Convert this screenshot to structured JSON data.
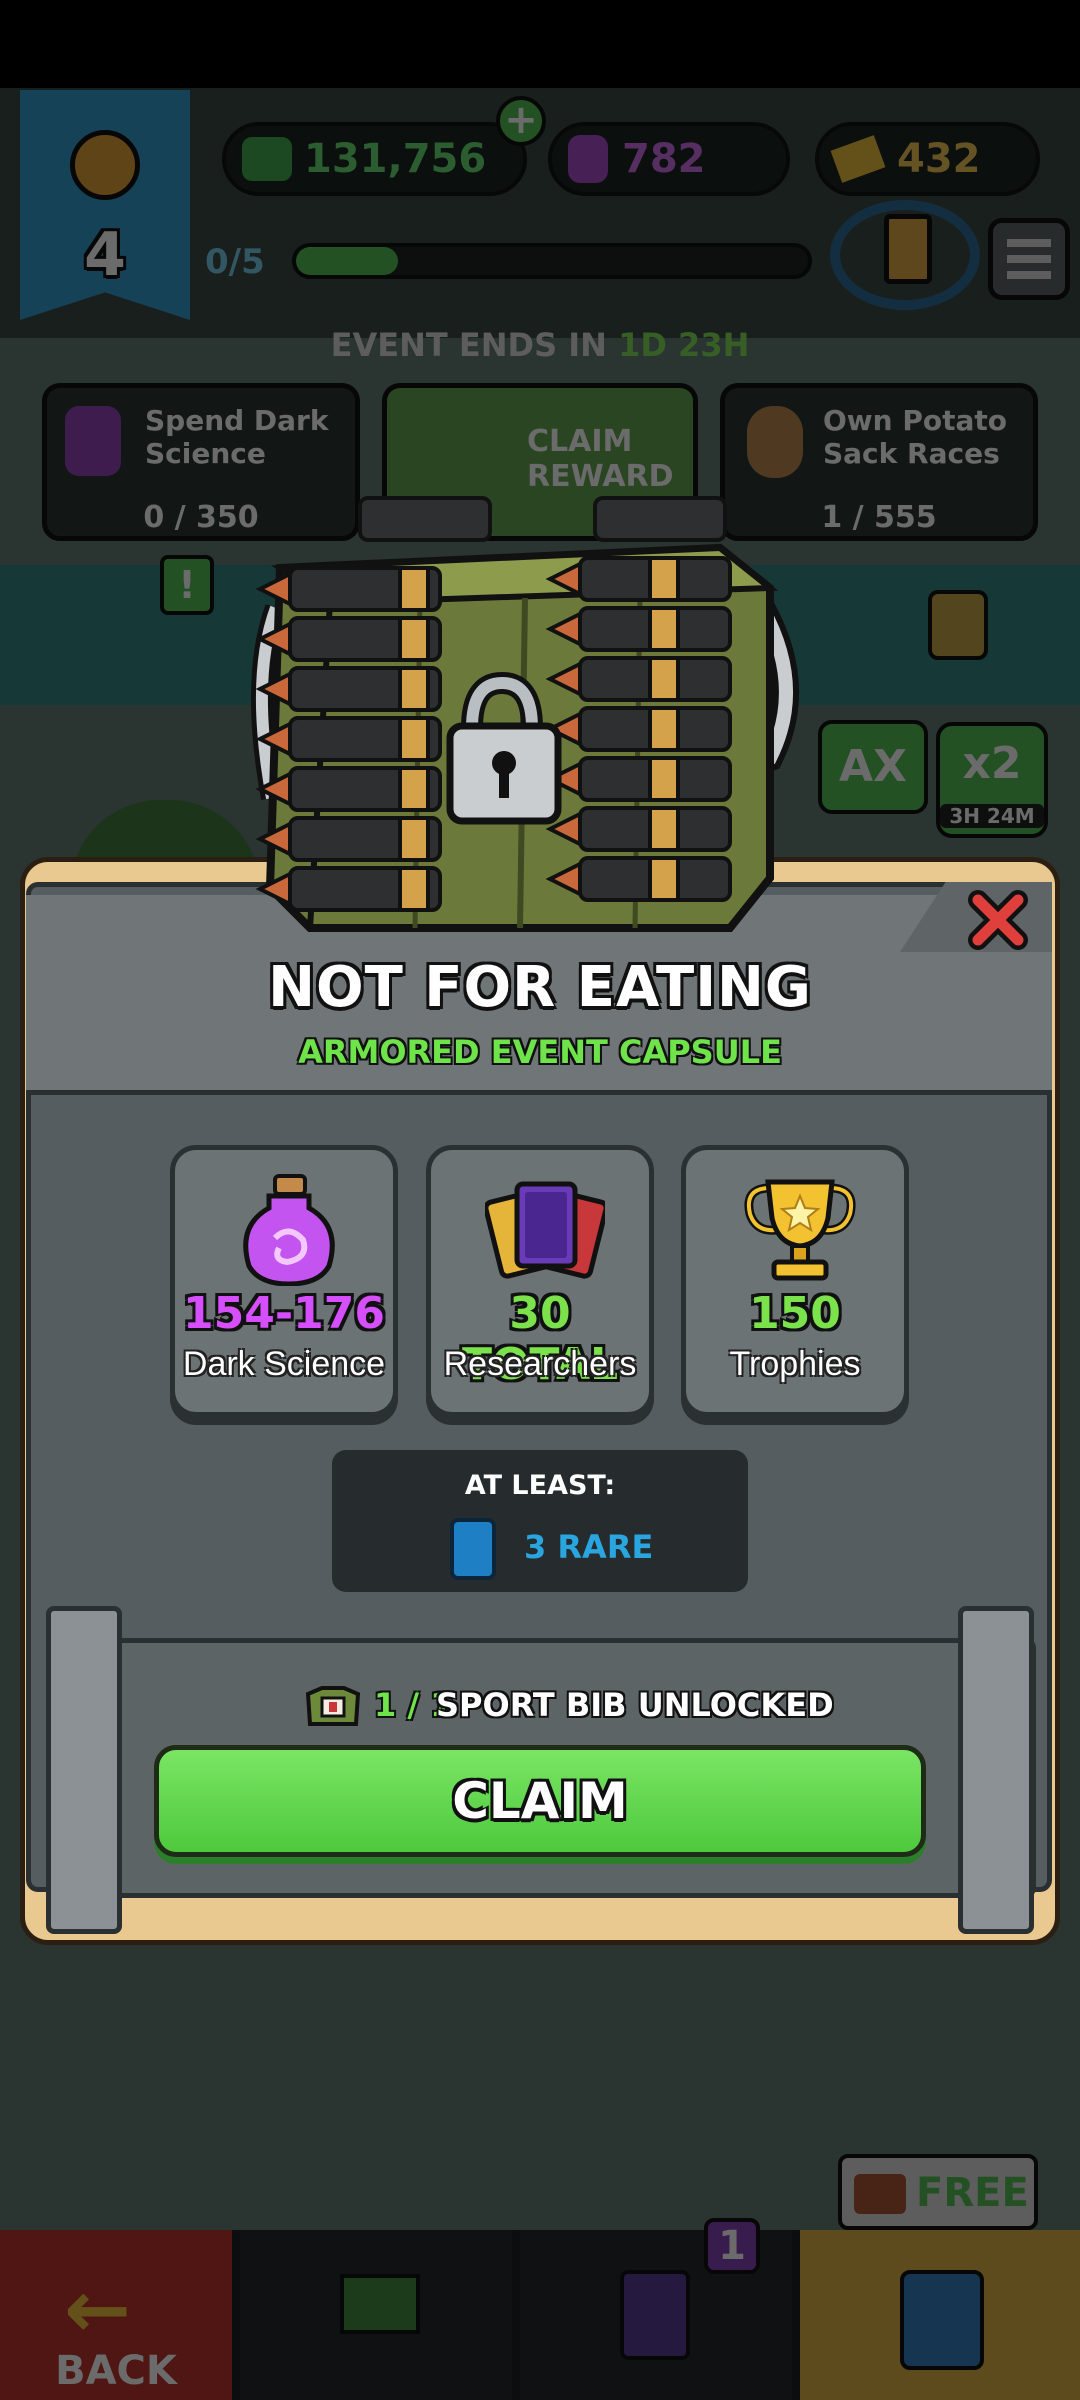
{
  "background": {
    "timer_level": "4",
    "currency_green": "131,756",
    "currency_dark_science": "782",
    "currency_tickets": "432",
    "progress_text": "0/5",
    "event_label": "EVENT ENDS IN",
    "event_days": "1D",
    "event_hours": "23H",
    "tasks": [
      {
        "title": "Spend Dark Science",
        "progress": "0 / 350"
      },
      {
        "title": "CLAIM REWARD",
        "progress": ""
      },
      {
        "title": "Own Potato Sack Races",
        "progress": "1 / 555"
      }
    ],
    "alert_badge": "!",
    "max_label": "AX",
    "multiplier": "x2",
    "multiplier_timer": "3H 24M",
    "nav": {
      "back": "BACK",
      "cards_badge": "1",
      "free_label": "FREE"
    }
  },
  "modal": {
    "title": "NOT FOR EATING",
    "subtitle": "ARMORED EVENT CAPSULE",
    "rewards": [
      {
        "value": "154-176",
        "label": "Dark Science",
        "value_color": "#d64fff",
        "icon": "dark-science-flask-icon"
      },
      {
        "value": "30 TOTAL",
        "label": "Researchers",
        "value_color": "#7be24c",
        "icon": "researcher-cards-icon"
      },
      {
        "value": "150",
        "label": "Trophies",
        "value_color": "#7be24c",
        "icon": "trophy-icon"
      }
    ],
    "at_least_label": "AT LEAST:",
    "rare_text": "3 RARE",
    "unlock_count": "1 / 1",
    "unlock_text": "SPORT BIB UNLOCKED",
    "claim_label": "CLAIM",
    "close_icon": "close-icon"
  }
}
